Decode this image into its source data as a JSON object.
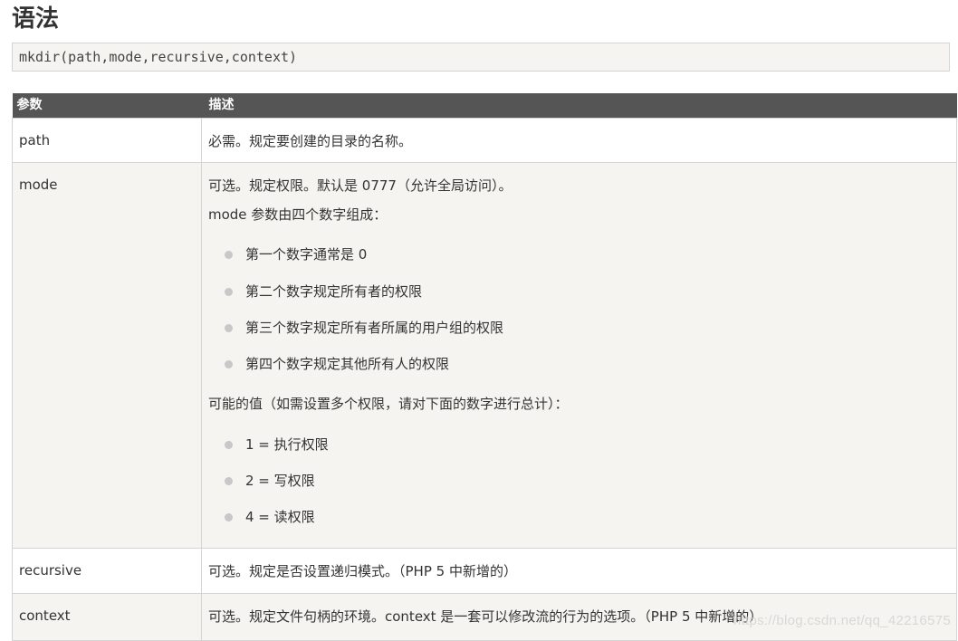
{
  "title": "语法",
  "syntax": "mkdir(path,mode,recursive,context)",
  "table": {
    "headers": [
      "参数",
      "描述"
    ],
    "rows": [
      {
        "name": "path",
        "desc": [
          "必需。规定要创建的目录的名称。"
        ]
      },
      {
        "name": "mode",
        "desc": [
          "可选。规定权限。默认是 0777（允许全局访问）。",
          "mode 参数由四个数字组成："
        ],
        "bullets1": [
          "第一个数字通常是 0",
          "第二个数字规定所有者的权限",
          "第三个数字规定所有者所属的用户组的权限",
          "第四个数字规定其他所有人的权限"
        ],
        "desc2": "可能的值（如需设置多个权限，请对下面的数字进行总计）：",
        "bullets2": [
          "1 = 执行权限",
          "2 = 写权限",
          "4 = 读权限"
        ]
      },
      {
        "name": "recursive",
        "desc": [
          "可选。规定是否设置递归模式。（PHP 5 中新增的）"
        ]
      },
      {
        "name": "context",
        "desc": [
          "可选。规定文件句柄的环境。context 是一套可以修改流的行为的选项。（PHP 5 中新增的）"
        ]
      }
    ]
  },
  "watermark": "https://blog.csdn.net/qq_42216575"
}
